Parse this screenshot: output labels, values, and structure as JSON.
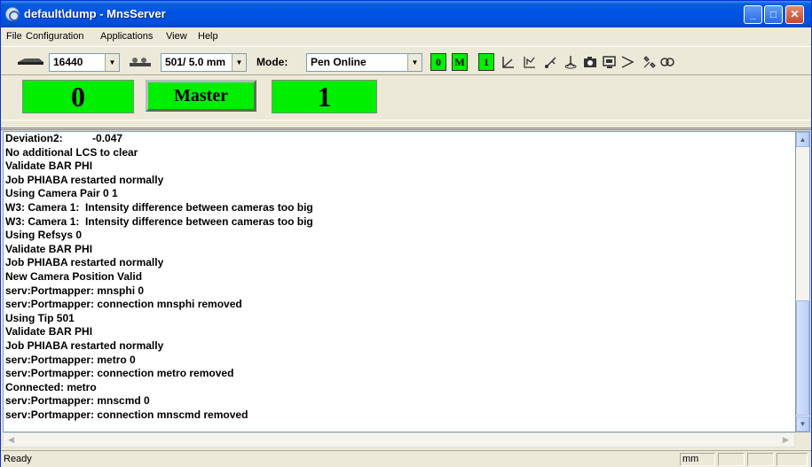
{
  "window": {
    "title": "default\\dump - MnsServer",
    "minimize_label": "_",
    "maximize_label": "□",
    "close_label": "✕"
  },
  "menu": [
    {
      "label": "File"
    },
    {
      "label": "Configuration"
    },
    {
      "label": "Applications"
    },
    {
      "label": "View"
    },
    {
      "label": "Help"
    }
  ],
  "toolbar": {
    "probe_combo_value": "16440",
    "tip_combo_value": "501/ 5.0 mm",
    "mode_label": "Mode:",
    "mode_combo_value": "Pen Online",
    "indicators": [
      {
        "label": "0",
        "color": "#00ee00"
      },
      {
        "label": "M",
        "color": "#00ee00"
      },
      {
        "label": "1",
        "color": "#00ee00"
      }
    ],
    "icons": [
      "axis-icon",
      "scan-icon",
      "probe-icon",
      "target-icon",
      "camera-icon",
      "display-icon",
      "forward-icon",
      "tools-icon",
      "pair-icon"
    ]
  },
  "display": {
    "left_value": "0",
    "master_label": "Master",
    "right_value": "1",
    "indicator_color": "#00ee00"
  },
  "log": [
    "Deviation2:          -0.047",
    "No additional LCS to clear",
    "Validate BAR PHI",
    "Job PHIABA restarted normally",
    "Using Camera Pair 0 1",
    "W3: Camera 1:  Intensity difference between cameras too big",
    "W3: Camera 1:  Intensity difference between cameras too big",
    "Using Refsys 0",
    "Validate BAR PHI",
    "Job PHIABA restarted normally",
    "New Camera Position Valid",
    "serv:Portmapper: mnsphi 0",
    "serv:Portmapper: connection mnsphi removed",
    "Using Tip 501",
    "Validate BAR PHI",
    "Job PHIABA restarted normally",
    "serv:Portmapper: metro 0",
    "serv:Portmapper: connection metro removed",
    "Connected: metro",
    "serv:Portmapper: mnscmd 0",
    "serv:Portmapper: connection mnscmd removed"
  ],
  "status": {
    "text": "Ready",
    "unit": "mm"
  }
}
